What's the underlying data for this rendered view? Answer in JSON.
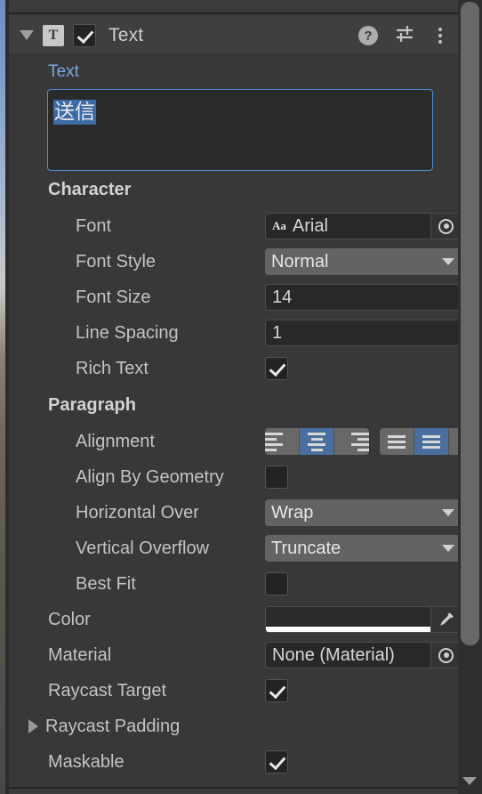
{
  "window": {
    "panel_bg": "#383838",
    "accent": "#4e8fd4",
    "selection_color": "#3d6ba5"
  },
  "header": {
    "title": "Text",
    "component_icon_letter": "T",
    "enabled": true,
    "help_glyph": "?",
    "icons": [
      "help-icon",
      "preset-icon",
      "more-menu-icon"
    ]
  },
  "text_property": {
    "label": "Text",
    "value": "送信"
  },
  "character": {
    "section": "Character",
    "font": {
      "label": "Font",
      "value": "Arial",
      "badge": "Aa"
    },
    "font_style": {
      "label": "Font Style",
      "value": "Normal"
    },
    "font_size": {
      "label": "Font Size",
      "value": "14"
    },
    "line_spacing": {
      "label": "Line Spacing",
      "value": "1"
    },
    "rich_text": {
      "label": "Rich Text",
      "checked": true
    }
  },
  "paragraph": {
    "section": "Paragraph",
    "alignment": {
      "label": "Alignment",
      "horizontal_options": [
        "align-left",
        "align-center",
        "align-right"
      ],
      "horizontal_selected": 1,
      "vertical_options": [
        "align-top",
        "align-middle",
        "align-bottom"
      ],
      "vertical_selected": 1
    },
    "align_by_geometry": {
      "label": "Align By Geometry",
      "checked": false
    },
    "horizontal_overflow": {
      "label": "Horizontal Overflow",
      "value": "Wrap"
    },
    "vertical_overflow": {
      "label": "Vertical Overflow",
      "value": "Truncate"
    },
    "best_fit": {
      "label": "Best Fit",
      "checked": false
    }
  },
  "graphic": {
    "color": {
      "label": "Color",
      "swatch": "#000000",
      "alpha_bar": "#ffffff"
    },
    "material": {
      "label": "Material",
      "value": "None (Material)"
    },
    "raycast_target": {
      "label": "Raycast Target",
      "checked": true
    },
    "raycast_padding": {
      "label": "Raycast Padding",
      "expanded": false
    },
    "maskable": {
      "label": "Maskable",
      "checked": true
    }
  }
}
